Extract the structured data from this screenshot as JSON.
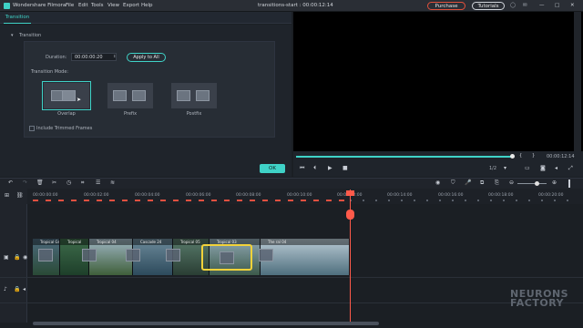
{
  "titlebar": {
    "app_name": "Wondershare Filmora",
    "menu": [
      "File",
      "Edit",
      "Tools",
      "View",
      "Export",
      "Help"
    ],
    "document_title": "transitions-start : 00:00:12:14",
    "purchase_label": "Purchase",
    "tutorials_label": "Tutorials",
    "colors": {
      "accent": "#3fd2c7",
      "purchase": "#e0503c"
    }
  },
  "left_panel": {
    "tab": "Transition",
    "section_title": "Transition",
    "duration_label": "Duration:",
    "duration_value": "00:00:00:20",
    "apply_all_label": "Apply to All",
    "mode_label": "Transition Mode:",
    "modes": [
      "Overlap",
      "Prefix",
      "Postfix"
    ],
    "selected_mode": "Overlap",
    "include_trimmed_label": "Include Trimmed Frames",
    "ok_label": "OK"
  },
  "preview": {
    "timecode": "00:00:12:14",
    "ratio": "1/2",
    "progress": 0.98
  },
  "timeline": {
    "ruler": [
      "00:00:00:00",
      "00:00:02:00",
      "00:00:04:00",
      "00:00:06:00",
      "00:00:08:00",
      "00:00:10:00",
      "00:00:12:00",
      "00:00:14:00",
      "00:00:16:00",
      "00:00:18:00",
      "00:00:20:00"
    ],
    "clips": [
      "Tropical Gr..",
      "Tropical",
      "Tropical 04",
      "Cascade 24",
      "Tropical 05",
      "Tropical 03",
      "The ral 04"
    ],
    "watermark_top": "NEURONS",
    "watermark_bottom": "FACTORY"
  }
}
